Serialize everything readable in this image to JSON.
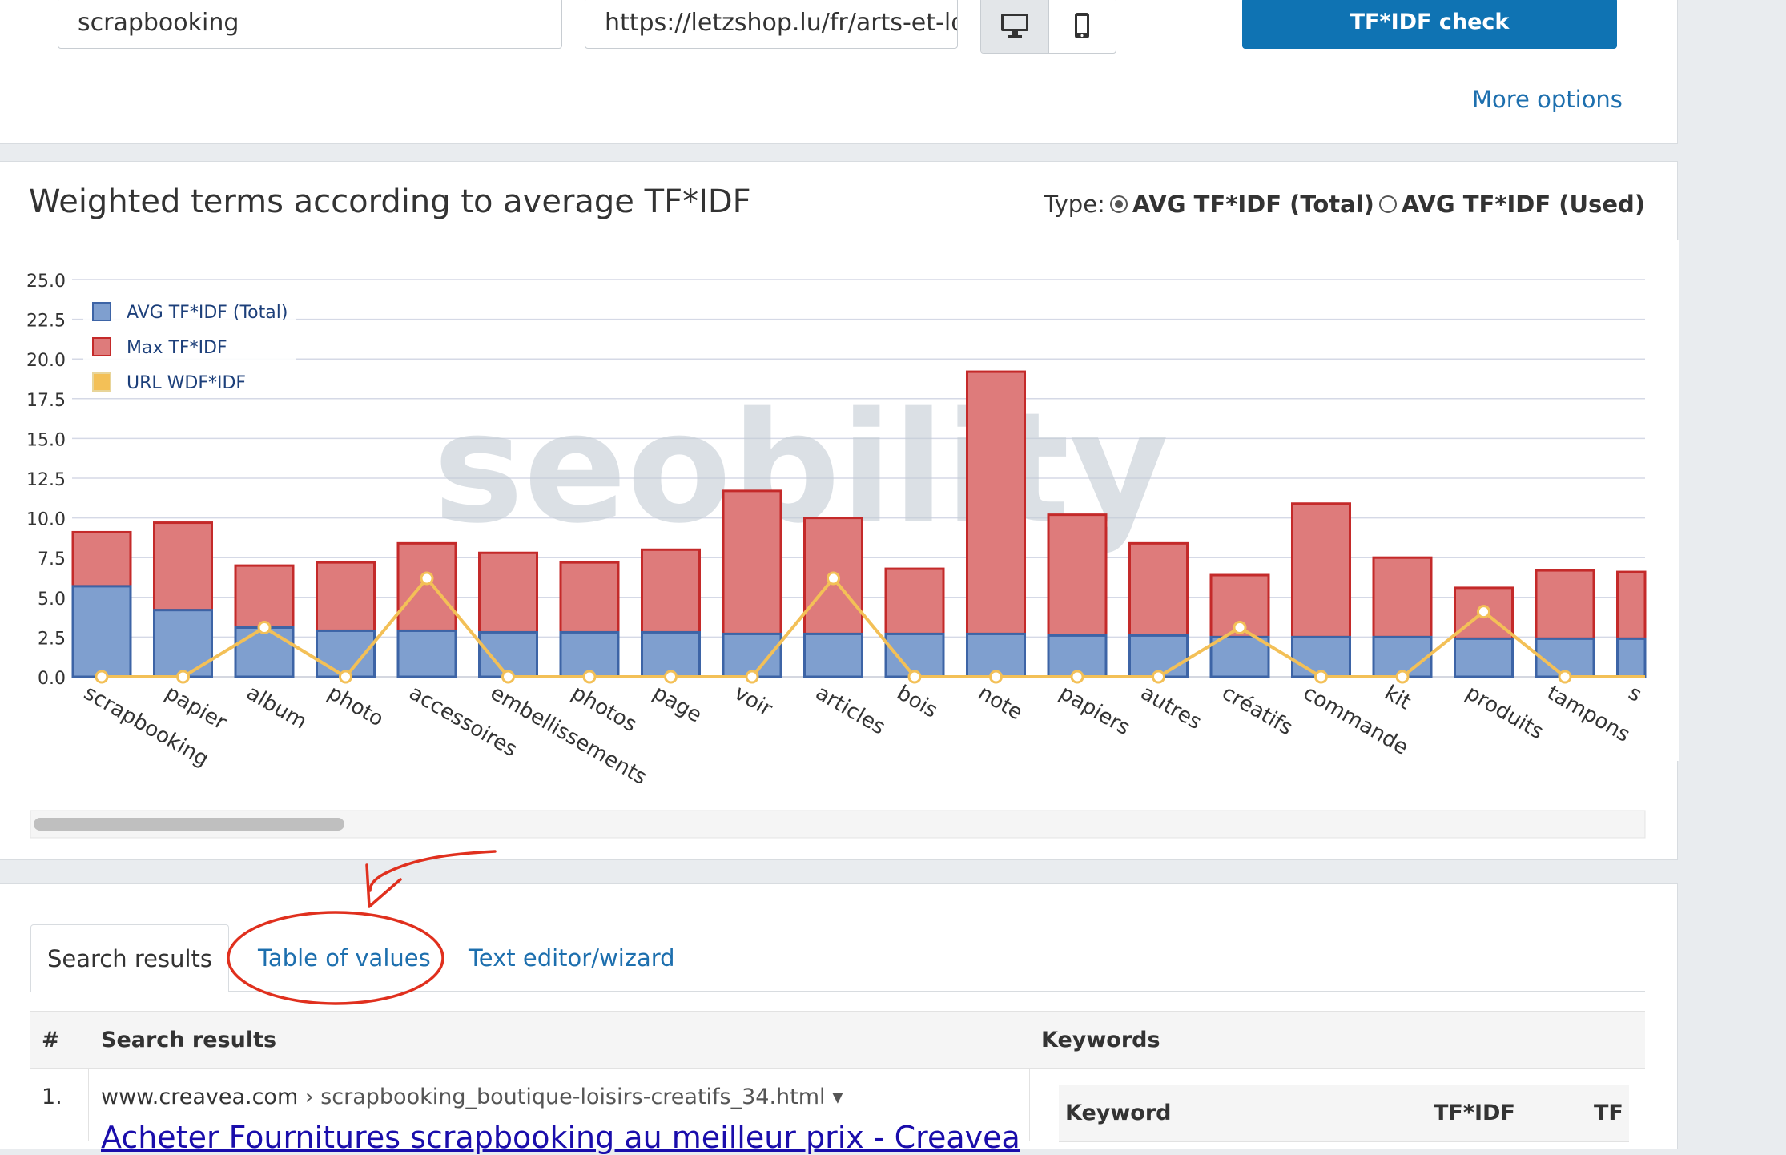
{
  "form": {
    "keyword_value": "scrapbooking",
    "url_value": "https://letzshop.lu/fr/arts-et-loi",
    "check_button": "TF*IDF check",
    "more_options": "More options"
  },
  "chart_section": {
    "title": "Weighted terms according to average TF*IDF",
    "type_label": "Type:",
    "type_options": [
      "AVG TF*IDF (Total)",
      "AVG TF*IDF (Used)"
    ],
    "selected_type": "AVG TF*IDF (Total)",
    "watermark": "seobility"
  },
  "chart_data": {
    "type": "bar",
    "stacked": true,
    "categories": [
      "scrapbooking",
      "papier",
      "album",
      "photo",
      "accessoires",
      "embellissements",
      "photos",
      "page",
      "voir",
      "articles",
      "bois",
      "note",
      "papiers",
      "autres",
      "créatifs",
      "commande",
      "kit",
      "produits",
      "tampons",
      "s"
    ],
    "series": [
      {
        "name": "AVG TF*IDF (Total)",
        "type": "bar",
        "color": "#7f9fcf",
        "border": "#3d64a6",
        "values": [
          5.7,
          4.2,
          3.1,
          2.9,
          2.9,
          2.8,
          2.8,
          2.8,
          2.7,
          2.7,
          2.7,
          2.7,
          2.6,
          2.6,
          2.5,
          2.5,
          2.5,
          2.4,
          2.4,
          2.4
        ]
      },
      {
        "name": "Max TF*IDF",
        "type": "bar",
        "color": "#de7b7b",
        "border": "#c42a2a",
        "values": [
          9.1,
          9.7,
          7.0,
          7.2,
          8.4,
          7.8,
          7.2,
          8.0,
          11.7,
          10.0,
          6.8,
          19.2,
          10.2,
          8.4,
          6.4,
          10.9,
          7.5,
          5.6,
          6.7,
          6.6
        ]
      },
      {
        "name": "URL WDF*IDF",
        "type": "line",
        "color": "#f3c057",
        "values": [
          0,
          0,
          3.1,
          0,
          6.2,
          0,
          0,
          0,
          0,
          6.2,
          0,
          0,
          0,
          0,
          3.1,
          0,
          0,
          4.1,
          0,
          0
        ]
      }
    ],
    "ylim": [
      0,
      25
    ],
    "yticks": [
      "0.0",
      "2.5",
      "5.0",
      "7.5",
      "10.0",
      "12.5",
      "15.0",
      "17.5",
      "20.0",
      "22.5",
      "25.0"
    ],
    "grid": true,
    "legend_position": "top-left"
  },
  "tabs": [
    {
      "label": "Search results",
      "active": true
    },
    {
      "label": "Table of values",
      "active": false
    },
    {
      "label": "Text editor/wizard",
      "active": false
    }
  ],
  "results_table": {
    "headers": [
      "#",
      "Search results",
      "Keywords"
    ],
    "rows": [
      {
        "num": "1.",
        "domain": "www.creavea.com",
        "path": "› scrapbooking_boutique-loisirs-creatifs_34.html ▾",
        "title": "Acheter Fournitures scrapbooking au meilleur prix - Creavea"
      }
    ],
    "keyword_headers": [
      "Keyword",
      "TF*IDF",
      "TF"
    ]
  }
}
